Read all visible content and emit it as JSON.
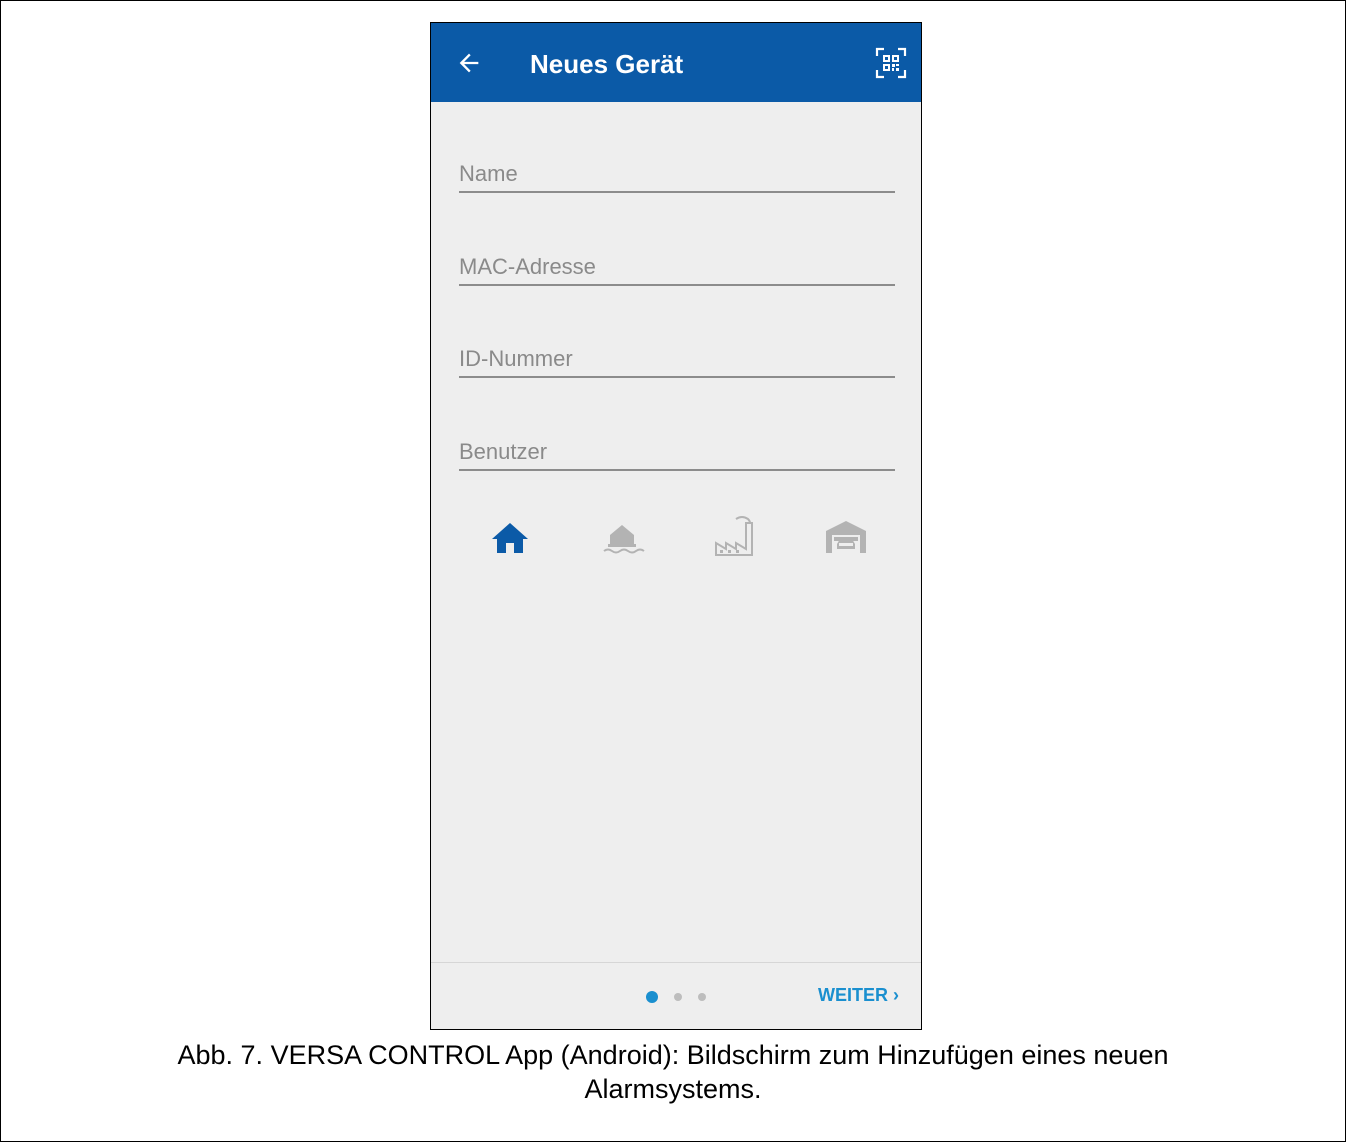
{
  "app": {
    "title": "Neues Gerät"
  },
  "icons": {
    "back": "arrow-left-icon",
    "qr": "qr-code-icon"
  },
  "fields": {
    "name": {
      "placeholder": "Name",
      "value": ""
    },
    "mac": {
      "placeholder": "MAC-Adresse",
      "value": ""
    },
    "id": {
      "placeholder": "ID-Nummer",
      "value": ""
    },
    "user": {
      "placeholder": "Benutzer",
      "value": ""
    }
  },
  "building_types": [
    {
      "icon": "house-icon",
      "selected": true
    },
    {
      "icon": "lakehouse-icon",
      "selected": false
    },
    {
      "icon": "factory-icon",
      "selected": false
    },
    {
      "icon": "garage-icon",
      "selected": false
    }
  ],
  "footer": {
    "next_label": "WEITER",
    "page_indicator": {
      "current": 1,
      "total": 3
    }
  },
  "caption": {
    "line1": "Abb. 7. VERSA CONTROL App (Android): Bildschirm zum Hinzufügen eines neuen",
    "line2": "Alarmsystems."
  },
  "colors": {
    "primary": "#0b5aa7",
    "accent": "#1a8fcf",
    "inactive_icon": "#b3b3b3",
    "background": "#eeeeee"
  }
}
